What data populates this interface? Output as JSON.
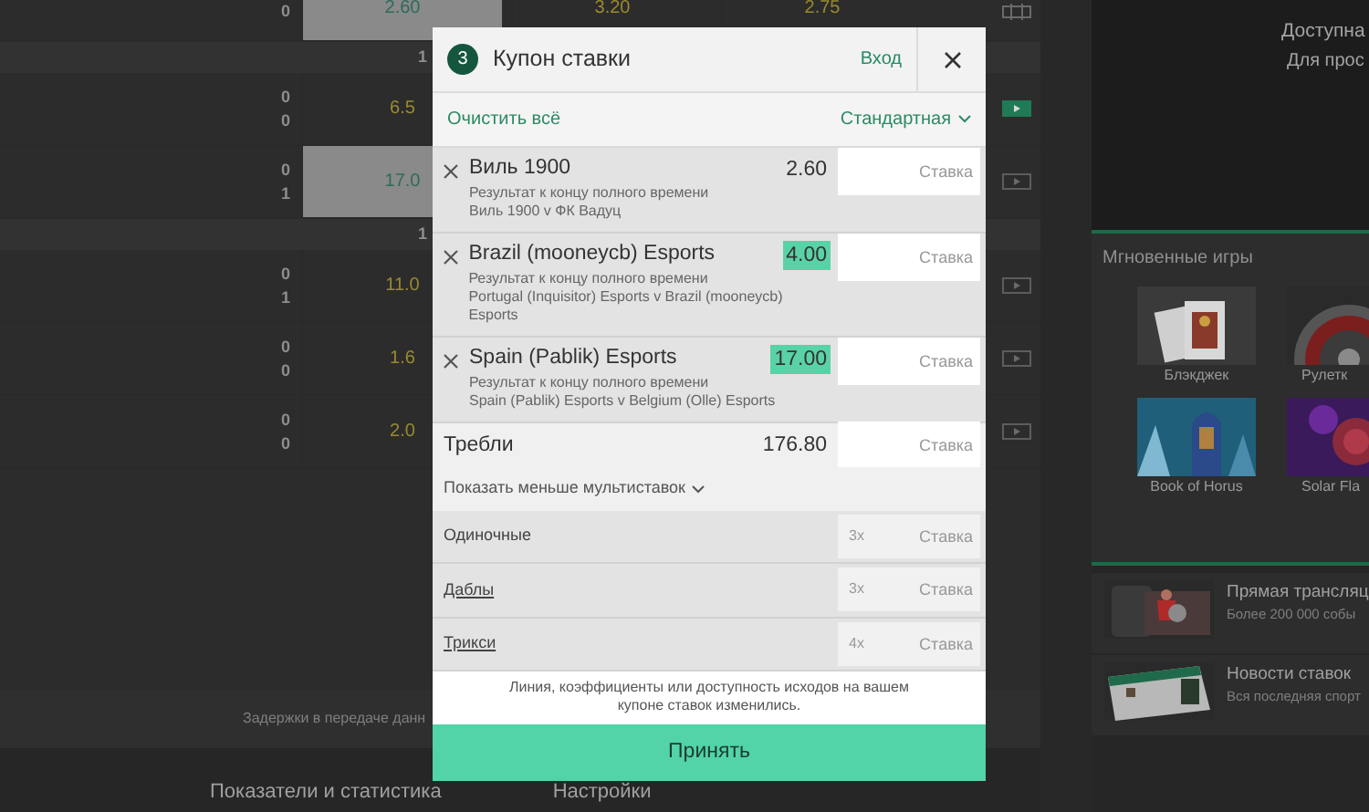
{
  "events": [
    {
      "kind": "top",
      "scores": [
        "0"
      ],
      "odds": [
        {
          "value": "2.60",
          "selected": true
        },
        {
          "value": "3.20",
          "selected": false
        },
        {
          "value": "2.75",
          "selected": false
        }
      ]
    },
    {
      "kind": "header",
      "label": "1"
    },
    {
      "kind": "event",
      "scores": [
        "0",
        "0"
      ],
      "odds": [
        {
          "value": "6.5",
          "selected": false
        }
      ],
      "active": true
    },
    {
      "kind": "event",
      "scores": [
        "0",
        "1"
      ],
      "odds": [
        {
          "value": "17.0",
          "selected": true
        }
      ],
      "active": false
    },
    {
      "kind": "header",
      "label": "1"
    },
    {
      "kind": "event",
      "scores": [
        "0",
        "1"
      ],
      "odds": [
        {
          "value": "11.0",
          "selected": false
        }
      ],
      "active": false
    },
    {
      "kind": "event",
      "scores": [
        "0",
        "0"
      ],
      "odds": [
        {
          "value": "1.6",
          "selected": false
        }
      ],
      "active": false
    },
    {
      "kind": "event",
      "scores": [
        "0",
        "0"
      ],
      "odds": [
        {
          "value": "2.0",
          "selected": false
        }
      ],
      "active": false
    }
  ],
  "footer_note": "Задержки в передаче данн",
  "bottom_links": [
    "Показатели и статистика",
    "Настройки"
  ],
  "stream_panel": {
    "title": "Доступна",
    "subtitle": "Для прос"
  },
  "instant_games": {
    "title": "Мгновенные игры",
    "games": [
      {
        "label": "Блэкджек"
      },
      {
        "label": "Рулетк"
      },
      {
        "label": "Book of Horus"
      },
      {
        "label": "Solar Fla"
      }
    ]
  },
  "promos": [
    {
      "title": "Прямая трансляц",
      "text": "Более 200 000 собы"
    },
    {
      "title": "Новости ставок",
      "text": "Вся последняя спорт"
    }
  ],
  "betslip": {
    "count": "3",
    "title": "Купон ставки",
    "login": "Вход",
    "clear": "Очистить всё",
    "mode": "Стандартная",
    "bets": [
      {
        "selection": "Виль 1900",
        "market": "Результат к концу полного времени",
        "event": "Виль 1900 v ФК Вадуц",
        "odds": "2.60",
        "odds_changed": false,
        "placeholder": "Ставка"
      },
      {
        "selection": "Brazil (mooneycb) Esports",
        "market": "Результат к концу полного времени",
        "event": "Portugal (Inquisitor) Esports v Brazil (mooneycb) Esports",
        "odds": "4.00",
        "odds_changed": true,
        "placeholder": "Ставка"
      },
      {
        "selection": "Spain (Pablik) Esports",
        "market": "Результат к концу полного времени",
        "event": "Spain (Pablik) Esports v Belgium (Olle) Esports",
        "odds": "17.00",
        "odds_changed": true,
        "placeholder": "Ставка"
      }
    ],
    "trebles": {
      "label": "Требли",
      "odds": "176.80",
      "placeholder": "Ставка"
    },
    "toggle": "Показать меньше мультиставок",
    "multiples": [
      {
        "label": "Одиночные",
        "count": "3x",
        "link": false,
        "placeholder": "Ставка"
      },
      {
        "label": "Даблы",
        "count": "3x",
        "link": true,
        "placeholder": "Ставка"
      },
      {
        "label": "Трикси",
        "count": "4x",
        "link": true,
        "placeholder": "Ставка"
      }
    ],
    "message": "Линия, коэффициенты или доступность исходов на вашем купоне ставок изменились.",
    "accept": "Принять"
  }
}
